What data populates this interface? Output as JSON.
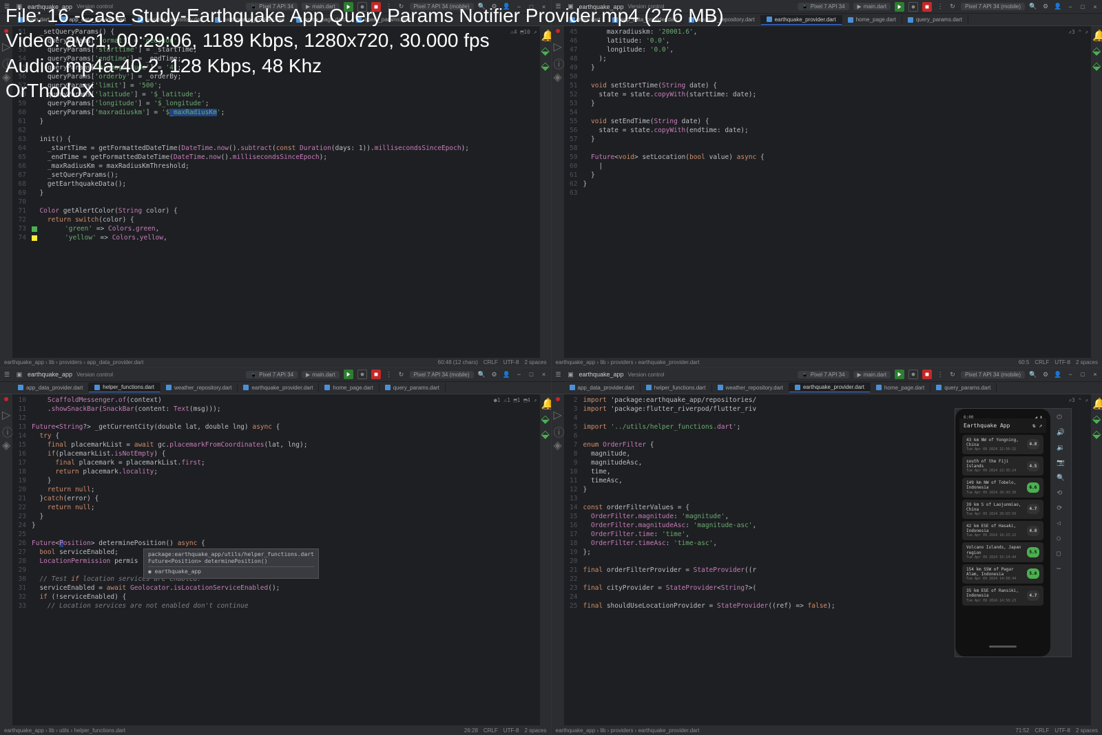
{
  "overlay": {
    "file_line": "File: 16 -Case Study-Earthquake App Query Params Notifier Provider.mp4 (276 MB)",
    "video_line": "Video: avc1, 00:29:06, 1189 Kbps, 1280x720, 30.000 fps",
    "audio_line": "Audio: mp4a-40-2, 128 Kbps, 48 Khz",
    "author": "OrThodoX"
  },
  "common": {
    "project": "earthquake_app",
    "version_control": "Version control",
    "device1": "Pixel 7 API 34",
    "main_file": "main.dart",
    "device_mobile": "Pixel 7 API 34 (mobile)"
  },
  "panels": {
    "tl": {
      "tabs": [
        "main.dart",
        "app_data_provider.dart",
        "weather_repository.dart",
        "earthquake_provider.dart",
        "home_page.dart",
        "query_params.dart"
      ],
      "active_tab": 1,
      "breadcrumb": [
        "earthquake_app",
        "lib",
        "providers",
        "app_data_provider.dart"
      ],
      "status_right": [
        "60:48 (12 chars)",
        "CRLF",
        "UTF-8",
        "2 spaces"
      ],
      "annotations": "⚠4 ⬒10 ↗",
      "code": [
        {
          "n": 51,
          "t": "  _setQueryParams() {"
        },
        {
          "n": 52,
          "t": "    queryParams['format'] = 'geojson';"
        },
        {
          "n": 53,
          "t": "    queryParams['starttime'] = _startTime;"
        },
        {
          "n": 54,
          "t": "    queryParams['endtime'] = _endTime;"
        },
        {
          "n": 55,
          "t": "    queryParams['minmagnitude'] = '4';"
        },
        {
          "n": 56,
          "t": "    queryParams['orderby'] = _orderBy;"
        },
        {
          "n": 57,
          "t": "    queryParams['limit'] = '500';"
        },
        {
          "n": 58,
          "t": "    queryParams['latitude'] = '$_latitude';"
        },
        {
          "n": 59,
          "t": "    queryParams['longitude'] = '$_longitude';"
        },
        {
          "n": 60,
          "t": "    queryParams['maxradiuskm'] = '$_maxRadiusKm';",
          "hl": "_maxRadiusKm"
        },
        {
          "n": 61,
          "t": "  }"
        },
        {
          "n": 62,
          "t": ""
        },
        {
          "n": 63,
          "t": "  init() {"
        },
        {
          "n": 64,
          "t": "    _startTime = getFormattedDateTime(DateTime.now().subtract(const Duration(days: 1)).millisecondsSinceEpoch);"
        },
        {
          "n": 65,
          "t": "    _endTime = getFormattedDateTime(DateTime.now().millisecondsSinceEpoch);"
        },
        {
          "n": 66,
          "t": "    _maxRadiusKm = maxRadiusKmThreshold;"
        },
        {
          "n": 67,
          "t": "    _setQueryParams();"
        },
        {
          "n": 68,
          "t": "    getEarthquakeData();"
        },
        {
          "n": 69,
          "t": "  }"
        },
        {
          "n": 70,
          "t": ""
        },
        {
          "n": 71,
          "t": "  Color getAlertColor(String color) {"
        },
        {
          "n": 72,
          "t": "    return switch(color) {"
        },
        {
          "n": 73,
          "t": "      'green' => Colors.green,",
          "sq": "#4caf50"
        },
        {
          "n": 74,
          "t": "      'yellow' => Colors.yellow,",
          "sq": "#ffeb3b"
        }
      ]
    },
    "tr": {
      "tabs": [
        "main.dart",
        "app_data_provider.dart",
        "weather_repository.dart",
        "earthquake_provider.dart",
        "home_page.dart",
        "query_params.dart"
      ],
      "active_tab": 3,
      "breadcrumb": [
        "earthquake_app",
        "lib",
        "providers",
        "earthquake_provider.dart"
      ],
      "status_right": [
        "60:5",
        "CRLF",
        "UTF-8",
        "2 spaces"
      ],
      "annotations": "↗3 ⌃ ↗",
      "code": [
        {
          "n": 45,
          "t": "      maxradiuskm: '20001.6',"
        },
        {
          "n": 46,
          "t": "      latitude: '0.0',"
        },
        {
          "n": 47,
          "t": "      longitude: '0.0',"
        },
        {
          "n": 48,
          "t": "    );"
        },
        {
          "n": 49,
          "t": "  }"
        },
        {
          "n": 50,
          "t": ""
        },
        {
          "n": 51,
          "t": "  void setStartTime(String date) {"
        },
        {
          "n": 52,
          "t": "    state = state.copyWith(starttime: date);"
        },
        {
          "n": 53,
          "t": "  }"
        },
        {
          "n": 54,
          "t": ""
        },
        {
          "n": 55,
          "t": "  void setEndTime(String date) {"
        },
        {
          "n": 56,
          "t": "    state = state.copyWith(endtime: date);"
        },
        {
          "n": 57,
          "t": "  }"
        },
        {
          "n": 58,
          "t": ""
        },
        {
          "n": 59,
          "t": "  Future<void> setLocation(bool value) async {"
        },
        {
          "n": 60,
          "t": "    |",
          "cursor": true
        },
        {
          "n": 61,
          "t": "  }"
        },
        {
          "n": 62,
          "t": "}"
        },
        {
          "n": 63,
          "t": ""
        }
      ]
    },
    "bl": {
      "tabs": [
        "app_data_provider.dart",
        "helper_functions.dart",
        "weather_repository.dart",
        "earthquake_provider.dart",
        "home_page.dart",
        "query_params.dart"
      ],
      "active_tab": 1,
      "breadcrumb": [
        "earthquake_app",
        "lib",
        "utils",
        "helper_functions.dart"
      ],
      "status_right": [
        "26:28",
        "CRLF",
        "UTF-8",
        "2 spaces"
      ],
      "annotations": "●1 ⚠1 ⬒1 ⬒4 ↗",
      "tooltip": {
        "path": "package:earthquake_app/utils/helper_functions.dart",
        "sig": "Future<Position> determinePosition()",
        "pkg": "earthquake_app"
      },
      "code": [
        {
          "n": 10,
          "t": "    ScaffoldMessenger.of(context)"
        },
        {
          "n": 11,
          "t": "    .showSnackBar(SnackBar(content: Text(msg)));"
        },
        {
          "n": 12,
          "t": ""
        },
        {
          "n": 13,
          "t": "Future<String?> _getCurrentCity(double lat, double lng) async {"
        },
        {
          "n": 14,
          "t": "  try {"
        },
        {
          "n": 15,
          "t": "    final placemarkList = await gc.placemarkFromCoordinates(lat, lng);"
        },
        {
          "n": 16,
          "t": "    if(placemarkList.isNotEmpty) {"
        },
        {
          "n": 17,
          "t": "      final placemark = placemarkList.first;"
        },
        {
          "n": 18,
          "t": "      return placemark.locality;"
        },
        {
          "n": 19,
          "t": "    }"
        },
        {
          "n": 20,
          "t": "    return null;"
        },
        {
          "n": 21,
          "t": "  }catch(error) {"
        },
        {
          "n": 22,
          "t": "    return null;"
        },
        {
          "n": 23,
          "t": "  }"
        },
        {
          "n": 24,
          "t": "}"
        },
        {
          "n": 25,
          "t": ""
        },
        {
          "n": 26,
          "t": "Future<Position> determinePosition() async {",
          "hl": "P"
        },
        {
          "n": 27,
          "t": "  bool serviceEnabled;"
        },
        {
          "n": 28,
          "t": "  LocationPermission permis"
        },
        {
          "n": 29,
          "t": ""
        },
        {
          "n": 30,
          "t": "  // Test if location services are enabled."
        },
        {
          "n": 31,
          "t": "  serviceEnabled = await Geolocator.isLocationServiceEnabled();"
        },
        {
          "n": 32,
          "t": "  if (!serviceEnabled) {"
        },
        {
          "n": 33,
          "t": "    // Location services are not enabled don't continue"
        }
      ]
    },
    "br": {
      "tabs": [
        "app_data_provider.dart",
        "helper_functions.dart",
        "weather_repository.dart",
        "earthquake_provider.dart",
        "home_page.dart",
        "query_params.dart"
      ],
      "active_tab": 3,
      "breadcrumb": [
        "earthquake_app",
        "lib",
        "providers",
        "earthquake_provider.dart"
      ],
      "status_right": [
        "71:52",
        "CRLF",
        "UTF-8",
        "2 spaces"
      ],
      "annotations": "↗3 ⌃ ↗",
      "code": [
        {
          "n": 2,
          "t": "import 'package:earthquake_app/repositories/"
        },
        {
          "n": 3,
          "t": "import 'package:flutter_riverpod/flutter_riv"
        },
        {
          "n": 4,
          "t": ""
        },
        {
          "n": 5,
          "t": "import '../utils/helper_functions.dart';"
        },
        {
          "n": 6,
          "t": ""
        },
        {
          "n": 7,
          "t": "enum OrderFilter {"
        },
        {
          "n": 8,
          "t": "  magnitude,"
        },
        {
          "n": 9,
          "t": "  magnitudeAsc,"
        },
        {
          "n": 10,
          "t": "  time,"
        },
        {
          "n": 11,
          "t": "  timeAsc,"
        },
        {
          "n": 12,
          "t": "}"
        },
        {
          "n": 13,
          "t": ""
        },
        {
          "n": 14,
          "t": "const orderFilterValues = {"
        },
        {
          "n": 15,
          "t": "  OrderFilter.magnitude: 'magnitude',"
        },
        {
          "n": 16,
          "t": "  OrderFilter.magnitudeAsc: 'magnitude-asc',"
        },
        {
          "n": 17,
          "t": "  OrderFilter.time: 'time',"
        },
        {
          "n": 18,
          "t": "  OrderFilter.timeAsc: 'time-asc',"
        },
        {
          "n": 19,
          "t": "};"
        },
        {
          "n": 20,
          "t": ""
        },
        {
          "n": 21,
          "t": "final orderFilterProvider = StateProvider((r"
        },
        {
          "n": 22,
          "t": ""
        },
        {
          "n": 23,
          "t": "final cityProvider = StateProvider<String?>("
        },
        {
          "n": 24,
          "t": ""
        },
        {
          "n": 25,
          "t": "final shouldUseLocationProvider = StateProvider((ref) => false);"
        }
      ],
      "emulator": {
        "title": "Earthquake App",
        "status_time": "6:00",
        "items": [
          {
            "title": "43 km NW of Yongning, China",
            "sub": "Tue Apr 09 2024 22:56:32",
            "mag": "4.8",
            "green": false
          },
          {
            "title": "south of the Fiji Islands",
            "sub": "Tue Apr 09 2024 22:35:24",
            "mag": "4.5",
            "green": false
          },
          {
            "title": "149 km NW of Tobelo, Indonesia",
            "sub": "Tue Apr 09 2024 20:43:30",
            "mag": "6.6",
            "green": true
          },
          {
            "title": "39 km S of Laojunmiao, China",
            "sub": "Tue Apr 09 2024 20:03:56",
            "mag": "4.7",
            "green": false
          },
          {
            "title": "42 km ESE of Hasaki, Indonesia",
            "sub": "Tue Apr 09 2024 18:25:22",
            "mag": "4.8",
            "green": false
          },
          {
            "title": "Volcano Islands, Japan region",
            "sub": "Tue Apr 09 2024 15:14:44",
            "mag": "5.5",
            "green": true
          },
          {
            "title": "154 km SSW of Pagar Alam, Indonesia",
            "sub": "Tue Apr 09 2024 14:58:44",
            "mag": "5.6",
            "green": true
          },
          {
            "title": "35 km ESE of Ransiki, Indonesia",
            "sub": "Tue Apr 09 2024 14:56:23",
            "mag": "4.7",
            "green": false
          }
        ]
      }
    }
  }
}
